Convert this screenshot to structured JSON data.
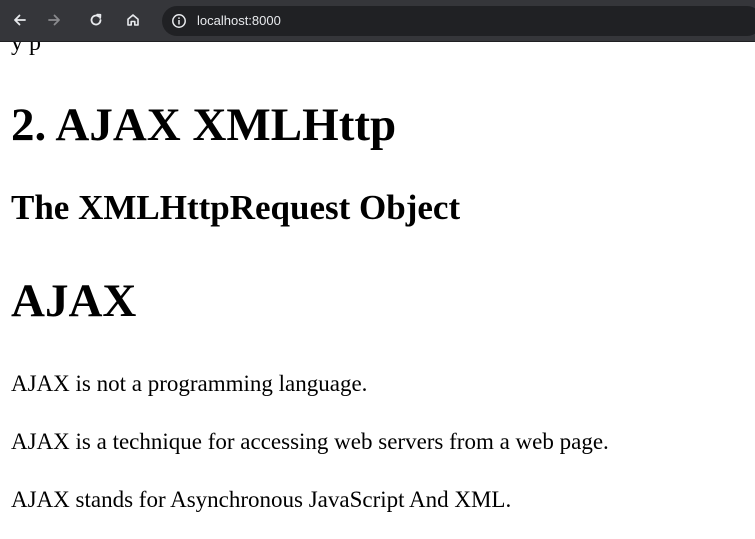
{
  "browser": {
    "url": "localhost:8000",
    "toolbar_color": "#35363a",
    "omnibox_color": "#202124"
  },
  "page": {
    "partial_line": "y                               p",
    "heading1": "2. AJAX XMLHttp",
    "heading2": "The XMLHttpRequest Object",
    "heading3": "AJAX",
    "paragraphs": [
      "AJAX is not a programming language.",
      "AJAX is a technique for accessing web servers from a web page.",
      "AJAX stands for Asynchronous JavaScript And XML."
    ]
  },
  "icons": {
    "back": "arrow-left-icon",
    "forward": "arrow-right-icon",
    "reload": "reload-icon",
    "home": "home-icon",
    "info": "info-icon"
  }
}
